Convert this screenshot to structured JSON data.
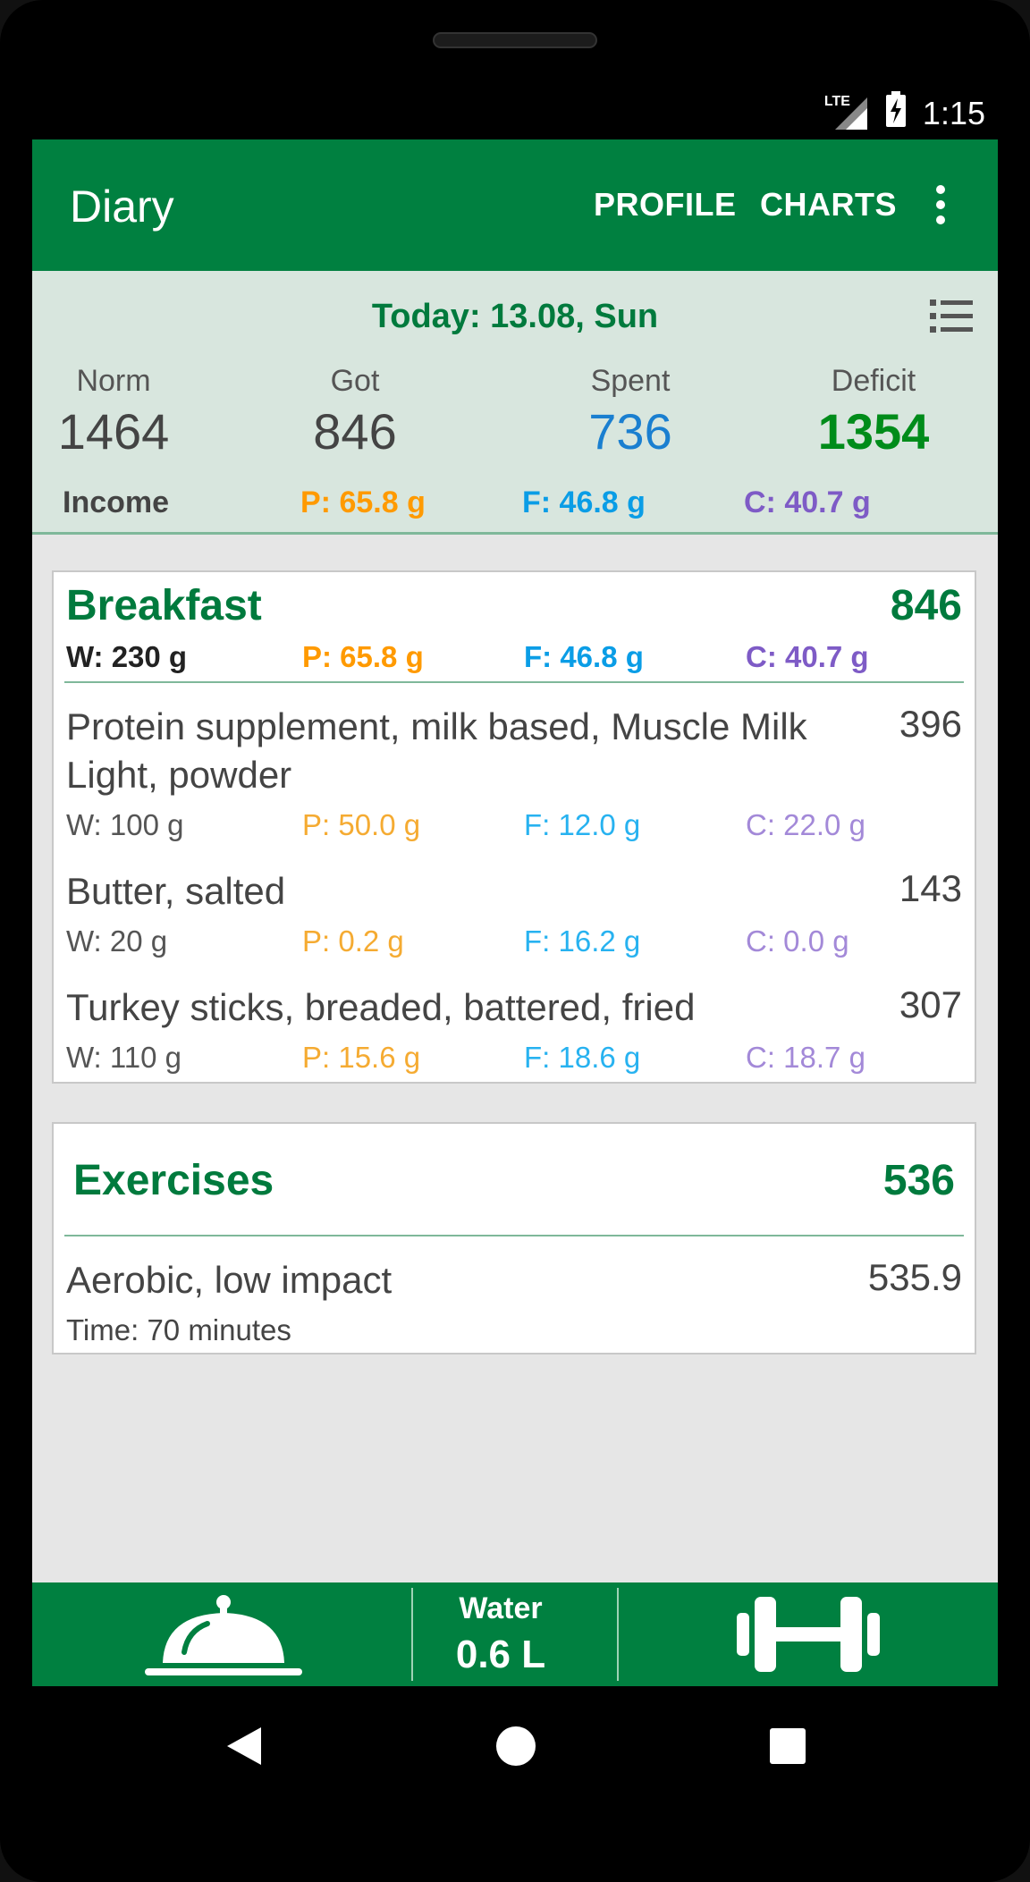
{
  "status": {
    "network": "LTE",
    "time": "1:15"
  },
  "appbar": {
    "title": "Diary",
    "actions": [
      "PROFILE",
      "CHARTS"
    ]
  },
  "summary": {
    "date": "Today: 13.08, Sun",
    "columns": [
      {
        "label": "Norm",
        "value": "1464"
      },
      {
        "label": "Got",
        "value": "846"
      },
      {
        "label": "Spent",
        "value": "736"
      },
      {
        "label": "Deficit",
        "value": "1354"
      }
    ],
    "income_label": "Income",
    "protein": "P: 65.8 g",
    "fat": "F: 46.8 g",
    "carbs": "C: 40.7 g"
  },
  "breakfast": {
    "title": "Breakfast",
    "total": "846",
    "weight": "W: 230 g",
    "protein": "P: 65.8 g",
    "fat": "F: 46.8 g",
    "carbs": "C: 40.7 g",
    "items": [
      {
        "name": "Protein supplement, milk based, Muscle Milk Light, powder",
        "kcal": "396",
        "w": "W: 100 g",
        "p": "P: 50.0 g",
        "f": "F: 12.0 g",
        "c": "C: 22.0 g"
      },
      {
        "name": "Butter, salted",
        "kcal": "143",
        "w": "W: 20 g",
        "p": "P: 0.2 g",
        "f": "F: 16.2 g",
        "c": "C: 0.0 g"
      },
      {
        "name": "Turkey sticks, breaded, battered, fried",
        "kcal": "307",
        "w": "W: 110 g",
        "p": "P: 15.6 g",
        "f": "F: 18.6 g",
        "c": "C: 18.7 g"
      }
    ]
  },
  "exercises": {
    "title": "Exercises",
    "total": "536",
    "items": [
      {
        "name": "Aerobic, low impact",
        "kcal": "535.9",
        "time": "Time: 70 minutes"
      }
    ]
  },
  "bottombar": {
    "water_label": "Water",
    "water_value": "0.6 L"
  },
  "colors": {
    "primary": "#008040",
    "protein": "#ff9a00",
    "fat": "#0a9de6",
    "carbs": "#7e5bc6",
    "spent": "#1a7fd0",
    "deficit": "#008c1a"
  }
}
